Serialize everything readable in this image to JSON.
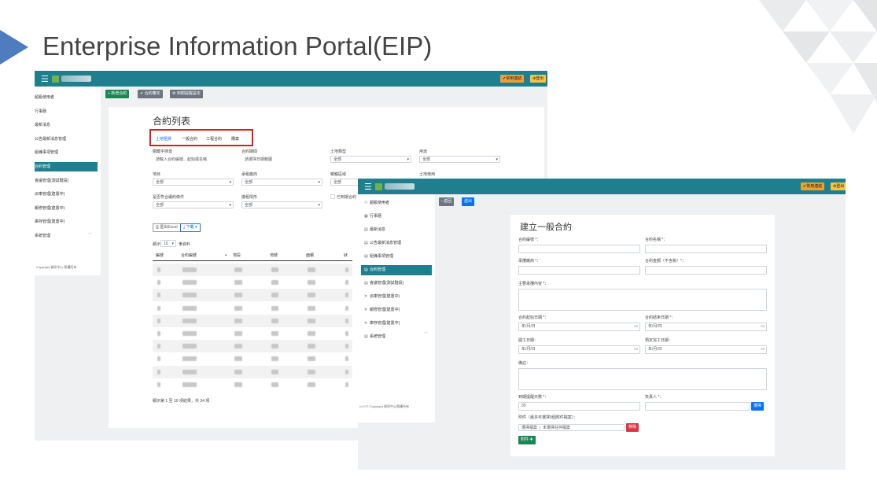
{
  "slide": {
    "title": "Enterprise Information Portal(EIP)"
  },
  "colors": {
    "topbar": "#1f7f8f",
    "accent_blue": "#0d6efd",
    "green": "#198754",
    "red_highlight": "#e01b1b",
    "arrow": "#4f7bbf"
  },
  "shot1": {
    "topbar": {
      "right_buttons": [
        "✔常用連結",
        "⊕登出"
      ]
    },
    "sidebar": {
      "items": [
        {
          "label": "超級使用者",
          "active": false
        },
        {
          "label": "行事曆",
          "active": false
        },
        {
          "label": "最新消息",
          "active": false
        },
        {
          "label": "公告最新消息管理",
          "active": false
        },
        {
          "label": "組織事項管理",
          "active": false
        },
        {
          "label": "合約管理",
          "active": true
        },
        {
          "label": "會議管理(測試階段)",
          "active": false
        },
        {
          "label": "派車管理(建置中)",
          "active": false
        },
        {
          "label": "報修管理(建置中)",
          "active": false
        },
        {
          "label": "庫存管理(建置中)",
          "active": false
        },
        {
          "label": "系統管理",
          "active": false
        }
      ],
      "footer": "Copyright 資訊中心 版權所有"
    },
    "toolbar": {
      "new_contract": "+ 新增合約",
      "contract_review": "✔ 合約審定",
      "notify_settings": "⚙ 到期提醒設定"
    },
    "card": {
      "title": "合約列表",
      "tabs": [
        "土地租賃",
        "一般合約",
        "工程合約",
        "購案"
      ],
      "filters": [
        {
          "label": "關鍵字搜尋",
          "value": "請輸入合約編號、起始或名稱",
          "kind": "text"
        },
        {
          "label": "合約期間",
          "value": "請選擇日期範圍",
          "kind": "text"
        },
        {
          "label": "土地類型",
          "value": "全部",
          "kind": "select"
        },
        {
          "label": "用途",
          "value": "全部",
          "kind": "select"
        },
        {
          "label": "地目",
          "value": "全部",
          "kind": "select"
        },
        {
          "label": "承租廠商",
          "value": "全部",
          "kind": "select"
        },
        {
          "label": "鄉鎮區域",
          "value": "全部",
          "kind": "select"
        },
        {
          "label": "土地使用",
          "value": "",
          "kind": "none"
        },
        {
          "label": "是否符合續約條件",
          "value": "全部",
          "kind": "select"
        },
        {
          "label": "繳租情形",
          "value": "全部",
          "kind": "select"
        },
        {
          "label": "已到期合約",
          "value": "",
          "kind": "check"
        }
      ],
      "export_buttons": [
        "⎙ 匯出Excel",
        "⤓ 下載 ▾"
      ],
      "page_size_prefix": "顯示",
      "page_size": "10",
      "page_size_suffix": "筆資料",
      "columns": [
        "編號",
        "合約編號",
        "地段",
        "地號",
        "面積",
        "狀"
      ],
      "summary": "顯示第 1 至 10 項結果，共 34 項"
    }
  },
  "shot2": {
    "topbar": {
      "right_buttons": [
        "✔常用連結",
        "⊕登出"
      ]
    },
    "sidebar": {
      "items": [
        {
          "icon": "⚇",
          "label": "超級使用者",
          "active": false
        },
        {
          "icon": "▦",
          "label": "行事曆",
          "active": false
        },
        {
          "icon": "▤",
          "label": "最新消息",
          "active": false
        },
        {
          "icon": "▤",
          "label": "公告最新消息管理",
          "active": false
        },
        {
          "icon": "▤",
          "label": "組織事項管理",
          "active": false
        },
        {
          "icon": "▤",
          "label": "合約管理",
          "active": true
        },
        {
          "icon": "▤",
          "label": "會議管理(測試階段)",
          "active": false
        },
        {
          "icon": "✕",
          "label": "派車管理(建置中)",
          "active": false
        },
        {
          "icon": "✕",
          "label": "報修管理(建置中)",
          "active": false
        },
        {
          "icon": "✕",
          "label": "庫存管理(建置中)",
          "active": false
        },
        {
          "icon": "▤",
          "label": "系統管理",
          "active": false
        }
      ],
      "footer": "v1.0 © Copyright 資訊中心版權所有"
    },
    "toolbar": {
      "back": "‹ 返回",
      "submit": "送出"
    },
    "form": {
      "title": "建立一般合約",
      "fields": [
        {
          "label": "合約編號 *：",
          "value": "",
          "kind": "text"
        },
        {
          "label": "合約名稱 *：",
          "value": "",
          "kind": "text"
        },
        {
          "label": "承攬廠商 *：",
          "value": "",
          "kind": "text"
        },
        {
          "label": "合約金額（不含稅）*：",
          "value": "",
          "kind": "text"
        },
        {
          "label": "主要承攬內容 *：",
          "value": "",
          "kind": "textarea"
        },
        {
          "label": "合約起始日期 *：",
          "value": "年/月/日",
          "kind": "date"
        },
        {
          "label": "合約結束日期 *：",
          "value": "年/月/日",
          "kind": "date"
        },
        {
          "label": "開工日期：",
          "value": "年/月/日",
          "kind": "date"
        },
        {
          "label": "預定完工日期：",
          "value": "年/月/日",
          "kind": "date"
        },
        {
          "label": "備註：",
          "value": "",
          "kind": "textarea"
        },
        {
          "label": "到期提醒天數 *：",
          "value": "30",
          "kind": "text"
        },
        {
          "label": "負責人 *：",
          "value": "",
          "kind": "text"
        }
      ],
      "select_button": "選擇",
      "attachment_label": "附件（最多可選擇5個附件檔案）：",
      "choose_file": "選擇檔案",
      "no_file": "未選擇任何檔案",
      "remove": "移除",
      "add_attachment": "附件 ✚"
    }
  }
}
